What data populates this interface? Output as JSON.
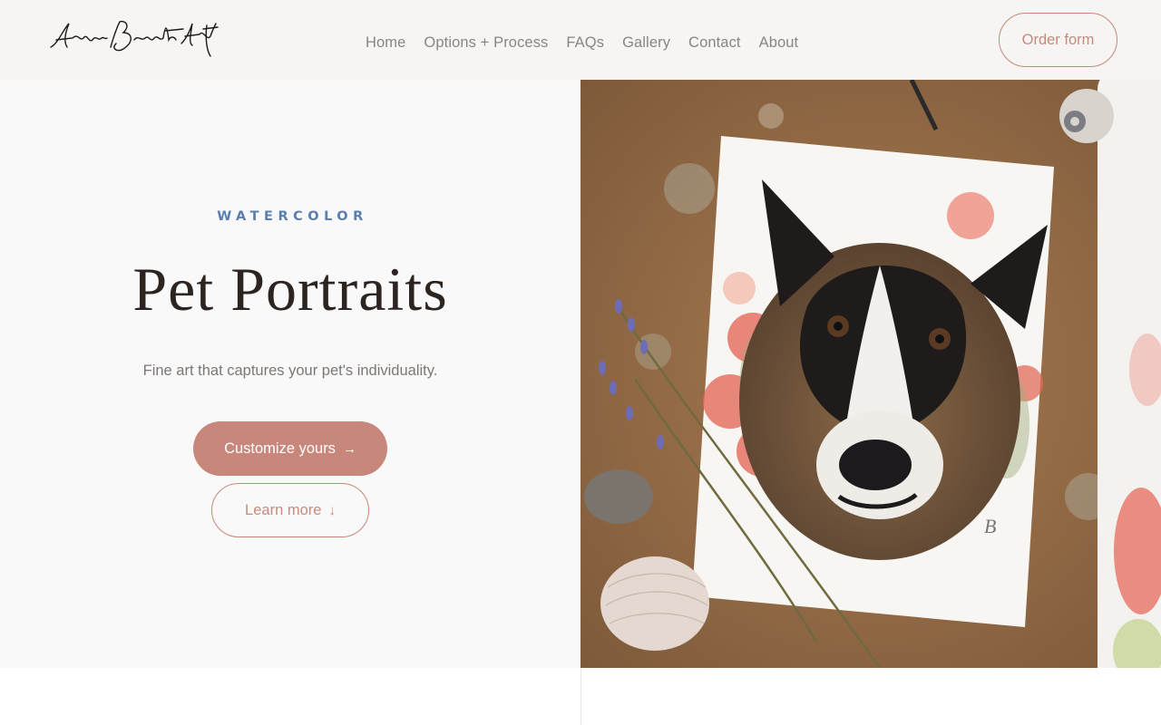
{
  "header": {
    "logo_text": "AnnaBarrettArt",
    "nav": [
      "Home",
      "Options + Process",
      "FAQs",
      "Gallery",
      "Contact",
      "About"
    ],
    "order_button": "Order form"
  },
  "hero": {
    "eyebrow": "WATERCOLOR",
    "title": "Pet Portraits",
    "subtitle": "Fine art that captures your pet's individuality.",
    "primary_button": "Customize yours",
    "primary_icon": "arrow-right-icon",
    "secondary_button": "Learn more",
    "secondary_icon": "arrow-down-icon"
  },
  "image": {
    "subject": "watercolor-dog-portrait-photo"
  },
  "colors": {
    "accent": "#c8877b",
    "eyebrow": "#5a7fae",
    "header_bg": "#f6f5f3"
  }
}
